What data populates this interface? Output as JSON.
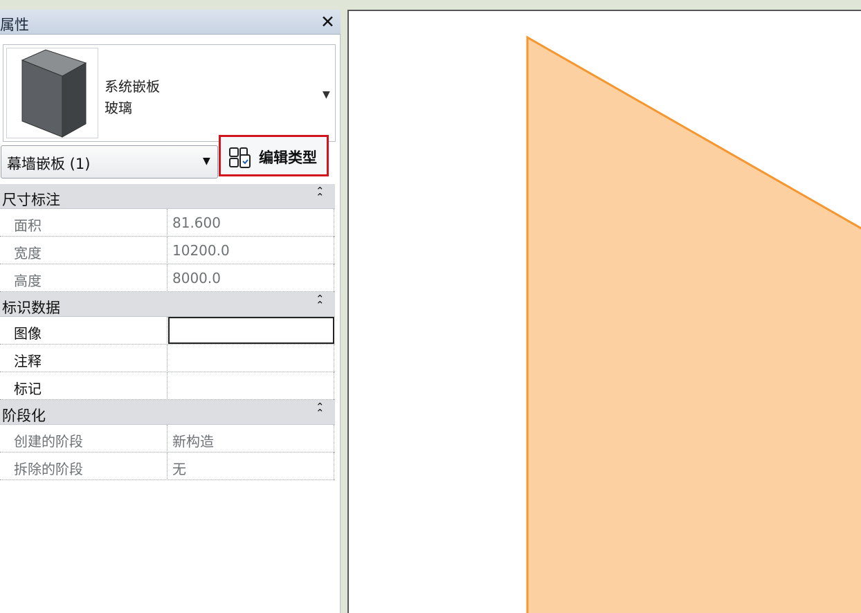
{
  "panel": {
    "title": "属性",
    "close_glyph": "✕"
  },
  "type_selector": {
    "family": "系统嵌板",
    "type": "玻璃",
    "preview_icon": "panel-block-icon",
    "arrow": "▼"
  },
  "instance_filter": {
    "label": "幕墙嵌板 (1)",
    "arrow": "▼"
  },
  "edit_type": {
    "label": "编辑类型",
    "icon": "edit-type-icon",
    "highlight_color": "#d3141c"
  },
  "groups": [
    {
      "title": "尺寸标注",
      "collapse_glyph": "≈",
      "rows": [
        {
          "name": "面积",
          "value": "81.600"
        },
        {
          "name": "宽度",
          "value": "10200.0"
        },
        {
          "name": "高度",
          "value": "8000.0"
        }
      ]
    },
    {
      "title": "标识数据",
      "collapse_glyph": "≈",
      "rows": [
        {
          "name": "图像",
          "value": ""
        },
        {
          "name": "注释",
          "value": ""
        },
        {
          "name": "标记",
          "value": ""
        }
      ]
    },
    {
      "title": "阶段化",
      "collapse_glyph": "≈",
      "rows": [
        {
          "name": "创建的阶段",
          "value": "新构造"
        },
        {
          "name": "拆除的阶段",
          "value": "无"
        }
      ]
    }
  ],
  "canvas": {
    "panel_fill": "#fdd0a2",
    "panel_stroke": "#f5962e"
  }
}
